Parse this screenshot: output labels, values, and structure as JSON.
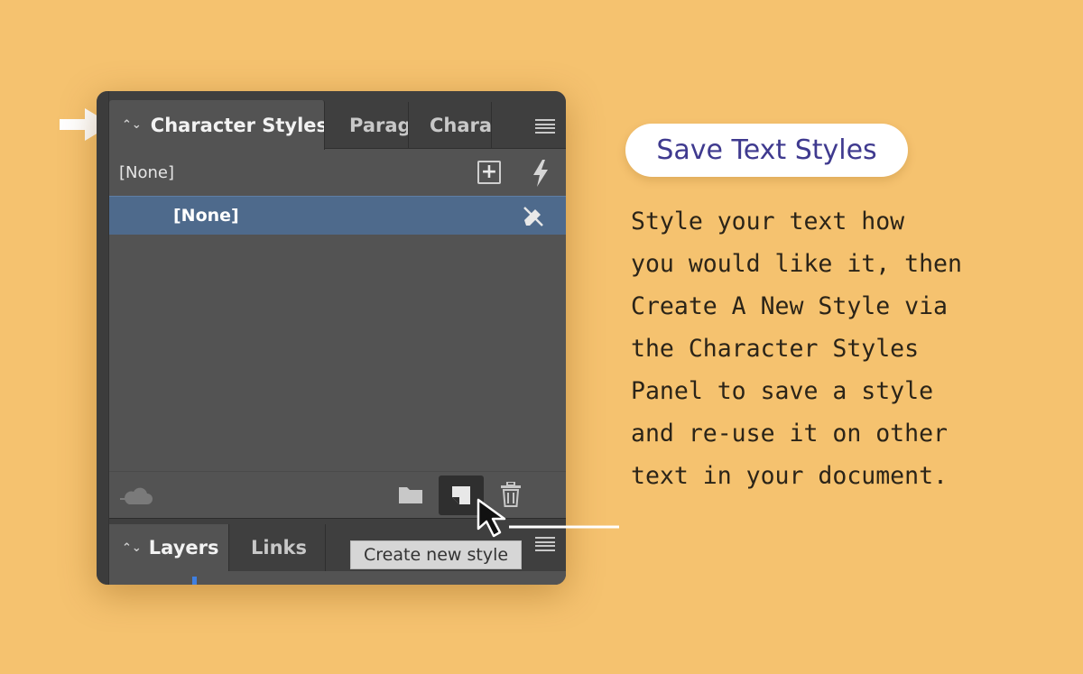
{
  "panel": {
    "tabs": [
      {
        "label": "Character Styles",
        "active": true
      },
      {
        "label": "Paragraph Styles",
        "active": false
      },
      {
        "label": "Character",
        "active": false
      }
    ],
    "header_style": "[None]",
    "selected_style": "[None]",
    "bottom_tabs": [
      {
        "label": "Layers",
        "active": true
      },
      {
        "label": "Links",
        "active": false
      }
    ],
    "tooltip": "Create new style",
    "icons": [
      "sort-chevron-icon",
      "panel-menu-icon",
      "new-group-icon",
      "quick-apply-icon",
      "clear-overrides-icon",
      "cc-library-icon",
      "folder-icon",
      "new-style-icon",
      "trash-icon",
      "mouse-pointer-icon"
    ]
  },
  "callout": {
    "title": "Save Text Styles",
    "lines": [
      "Style your text how",
      "you would like it, then",
      "Create A New Style via",
      "the Character Styles",
      "Panel to save a style",
      "and re-use it on other",
      "text in your document."
    ]
  },
  "colors": {
    "background": "#f5c26f",
    "panel": "#535353",
    "selection": "#4e6a8c",
    "title_text": "#3f3a8f"
  }
}
